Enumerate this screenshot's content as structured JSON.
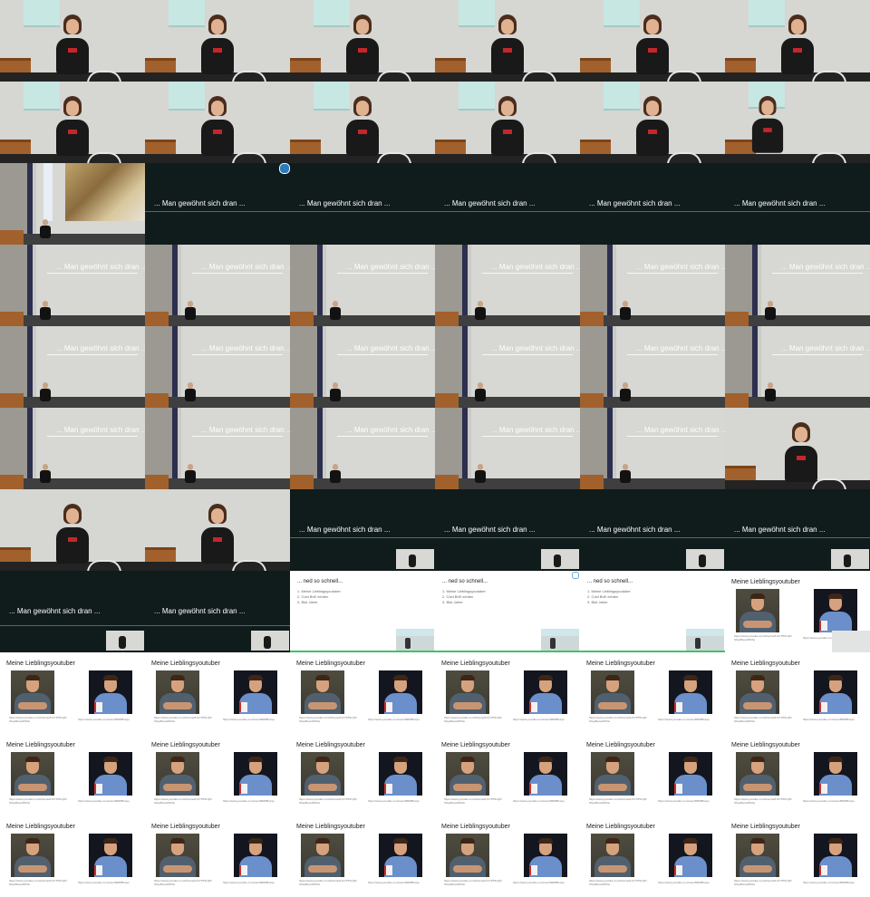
{
  "grid": {
    "columns": 6,
    "rows": 11
  },
  "texts": {
    "man_gewoehnt": "... Man gewöhnt sich dran ...",
    "ned_so_schnell": "... ned so schnell...",
    "list_items": [
      "1. Meine Lieblingsyoutuber",
      "2. Cold Brill' echten",
      "3. Blut Jahre"
    ],
    "youtuber_title": "Meine Lieblingsyoutuber",
    "url_left": "https://www.youtube.com/channel/UCY9T5LQ6l ShopBoredWKho",
    "url_right": "https://www.youtube.com/user/MRMBrunjo"
  },
  "icons": {
    "pause": "pause-icon"
  },
  "colors": {
    "dark_bg": "#101b1b",
    "accent_green": "#43c06a",
    "podium": "#a2612c",
    "screen": "#c7e7e3"
  },
  "frames": [
    {
      "type": "cam"
    },
    {
      "type": "cam"
    },
    {
      "type": "cam"
    },
    {
      "type": "cam"
    },
    {
      "type": "cam"
    },
    {
      "type": "cam"
    },
    {
      "type": "cam2"
    },
    {
      "type": "cam2"
    },
    {
      "type": "cam2"
    },
    {
      "type": "cam2"
    },
    {
      "type": "cam2"
    },
    {
      "type": "cam3"
    },
    {
      "type": "hall_img"
    },
    {
      "type": "dark",
      "pause": true
    },
    {
      "type": "dark"
    },
    {
      "type": "dark"
    },
    {
      "type": "dark"
    },
    {
      "type": "dark"
    },
    {
      "type": "hall"
    },
    {
      "type": "hall"
    },
    {
      "type": "hall"
    },
    {
      "type": "hall"
    },
    {
      "type": "hall"
    },
    {
      "type": "hall"
    },
    {
      "type": "hall"
    },
    {
      "type": "hall"
    },
    {
      "type": "hall"
    },
    {
      "type": "hall"
    },
    {
      "type": "hall"
    },
    {
      "type": "hall"
    },
    {
      "type": "hall"
    },
    {
      "type": "hall"
    },
    {
      "type": "hall"
    },
    {
      "type": "hall"
    },
    {
      "type": "hall"
    },
    {
      "type": "cam4"
    },
    {
      "type": "cam5"
    },
    {
      "type": "cam5"
    },
    {
      "type": "dark",
      "inset": true
    },
    {
      "type": "dark",
      "inset": true
    },
    {
      "type": "dark",
      "inset": true
    },
    {
      "type": "dark",
      "inset": true
    },
    {
      "type": "dark2",
      "inset": true
    },
    {
      "type": "dark2",
      "inset": true
    },
    {
      "type": "white",
      "inset": true
    },
    {
      "type": "white",
      "inset": true,
      "dot": true
    },
    {
      "type": "white",
      "inset": true
    },
    {
      "type": "yt",
      "inset": true
    },
    {
      "type": "yt"
    },
    {
      "type": "yt"
    },
    {
      "type": "yt"
    },
    {
      "type": "yt"
    },
    {
      "type": "yt"
    },
    {
      "type": "yt"
    },
    {
      "type": "yt"
    },
    {
      "type": "yt"
    },
    {
      "type": "yt"
    },
    {
      "type": "yt"
    },
    {
      "type": "yt"
    },
    {
      "type": "yt"
    },
    {
      "type": "yt"
    },
    {
      "type": "yt"
    },
    {
      "type": "yt"
    },
    {
      "type": "yt"
    },
    {
      "type": "yt"
    },
    {
      "type": "yt"
    }
  ]
}
